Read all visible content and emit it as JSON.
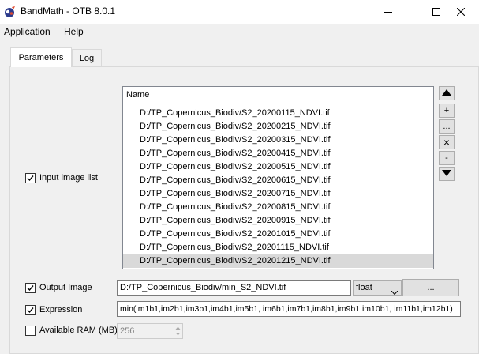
{
  "window": {
    "title": "BandMath  -  OTB 8.0.1",
    "icon": "otb-logo-icon",
    "controls": [
      "minimize-icon",
      "maximize-icon",
      "close-icon"
    ]
  },
  "menu": {
    "items": [
      "Application",
      "Help"
    ]
  },
  "tabs": [
    {
      "label": "Parameters",
      "active": true
    },
    {
      "label": "Log",
      "active": false
    }
  ],
  "input_image_list": {
    "label": "Input image list",
    "checked": true,
    "header": "Name",
    "items": [
      "D:/TP_Copernicus_Biodiv/S2_20200115_NDVI.tif",
      "D:/TP_Copernicus_Biodiv/S2_20200215_NDVI.tif",
      "D:/TP_Copernicus_Biodiv/S2_20200315_NDVI.tif",
      "D:/TP_Copernicus_Biodiv/S2_20200415_NDVI.tif",
      "D:/TP_Copernicus_Biodiv/S2_20200515_NDVI.tif",
      "D:/TP_Copernicus_Biodiv/S2_20200615_NDVI.tif",
      "D:/TP_Copernicus_Biodiv/S2_20200715_NDVI.tif",
      "D:/TP_Copernicus_Biodiv/S2_20200815_NDVI.tif",
      "D:/TP_Copernicus_Biodiv/S2_20200915_NDVI.tif",
      "D:/TP_Copernicus_Biodiv/S2_20201015_NDVI.tif",
      "D:/TP_Copernicus_Biodiv/S2_20201115_NDVI.tif",
      "D:/TP_Copernicus_Biodiv/S2_20201215_NDVI.tif"
    ],
    "selected_index": 11,
    "buttons": {
      "move_up": "up-arrow-icon",
      "add": "+",
      "browse": "...",
      "remove": "×",
      "remove_all": "-",
      "move_down": "down-arrow-icon"
    }
  },
  "output_image": {
    "label": "Output Image",
    "checked": true,
    "value": "D:/TP_Copernicus_Biodiv/min_S2_NDVI.tif",
    "type": "float",
    "browse_label": "..."
  },
  "expression": {
    "label": "Expression",
    "checked": true,
    "value": "min(im1b1,im2b1,im3b1,im4b1,im5b1, im6b1,im7b1,im8b1,im9b1,im10b1, im11b1,im12b1)"
  },
  "available_ram": {
    "label": "Available RAM (MB)",
    "checked": false,
    "value": "256"
  }
}
